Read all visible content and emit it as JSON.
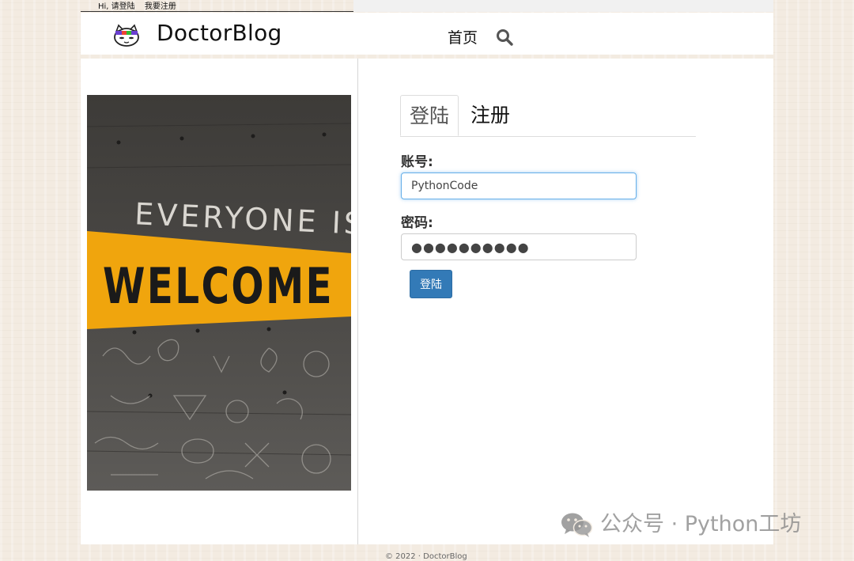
{
  "topbar": {
    "greeting": "Hi, 请登陆",
    "register_link": "我要注册"
  },
  "header": {
    "brand": "DoctorBlog",
    "nav_home": "首页",
    "search_icon": "search-icon",
    "logo_icon": "cat-mascot-icon"
  },
  "hero_image": {
    "line1": "EVERYONE IS",
    "line2": "WELCOME"
  },
  "login_form": {
    "tabs": [
      {
        "label": "登陆",
        "active": true
      },
      {
        "label": "注册",
        "active": false
      }
    ],
    "username_label": "账号:",
    "username_value": "PythonCode",
    "password_label": "密码:",
    "password_value": "●●●●●●●●●●",
    "submit_label": "登陆"
  },
  "footer": {
    "text": "© 2022 · DoctorBlog"
  },
  "watermark": {
    "text": "公众号 · Python工坊",
    "icon": "wechat-icon"
  },
  "colors": {
    "primary": "#337ab7",
    "focus_border": "#66afe9",
    "banner_yellow": "#f0a50d"
  }
}
